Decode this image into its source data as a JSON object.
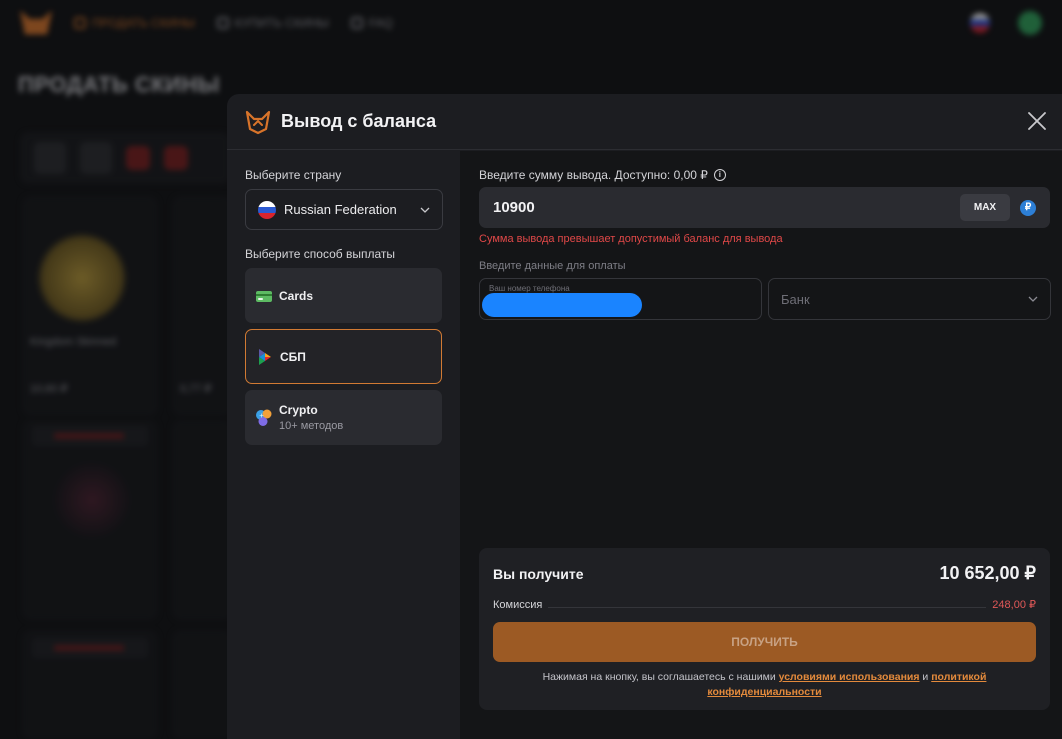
{
  "background": {
    "nav": [
      "ПРОДАТЬ СКИНЫ",
      "КУПИТЬ СКИНЫ",
      "FAQ"
    ],
    "page_title": "ПРОДАТЬ СКИНЫ",
    "card1_name": "Kingdom Skinned",
    "card1_price": "10,60 ₽",
    "card2_price": "0,77 ₽"
  },
  "modal": {
    "title": "Вывод с баланса",
    "close_icon": "close-icon"
  },
  "left": {
    "country_label": "Выберите страну",
    "country_value": "Russian Federation",
    "method_label": "Выберите способ выплаты",
    "methods": [
      {
        "title": "Cards",
        "subtitle": "",
        "icon": "card-icon"
      },
      {
        "title": "СБП",
        "subtitle": "",
        "icon": "sbp-icon",
        "active": true
      },
      {
        "title": "Crypto",
        "subtitle": "10+ методов",
        "icon": "crypto-icon"
      }
    ]
  },
  "form": {
    "amount_label": "Введите сумму вывода. Доступно: 0,00 ₽",
    "amount_value": "10900",
    "max_label": "MAX",
    "currency_symbol": "₽",
    "error": "Сумма вывода превышает допустимый баланс для вывода",
    "payment_label": "Введите данные для оплаты",
    "phone_placeholder": "Ваш номер телефона",
    "bank_placeholder": "Банк"
  },
  "summary": {
    "receive_label": "Вы получите",
    "receive_value": "10 652,00 ₽",
    "fee_label": "Комиссия",
    "fee_value": "248,00 ₽",
    "button_label": "ПОЛУЧИТЬ",
    "legal_prefix": "Нажимая на кнопку, вы соглашаетесь с нашими ",
    "terms_link": "условиями использования",
    "legal_and": " и ",
    "privacy_link": "политикой конфиденциальности"
  },
  "colors": {
    "accent": "#d17a33",
    "error": "#e04848",
    "button": "#9c5a24"
  }
}
